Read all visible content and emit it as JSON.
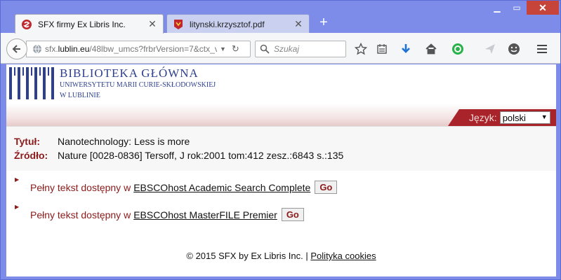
{
  "browser": {
    "tabs": [
      {
        "title": "SFX firmy Ex Libris Inc.",
        "active": true
      },
      {
        "title": "litynski.krzysztof.pdf",
        "active": false
      }
    ],
    "url_prefix": "sfx.",
    "url_domain": "lublin.eu",
    "url_rest": "/48lbw_umcs?frbrVersion=7&ctx_v",
    "search_placeholder": "Szukaj"
  },
  "header": {
    "title": "BIBLIOTEKA GŁÓWNA",
    "subtitle1": "UNIWERSYTETU MARII CURIE-SKŁODOWSKIEJ",
    "subtitle2": "W LUBLINIE",
    "language_label": "Język:",
    "language_value": "polski"
  },
  "record": {
    "title_label": "Tytuł:",
    "title_value": "Nanotechnology: Less is more",
    "source_label": "Źródło:",
    "source_value": "Nature [0028-0836] Tersoff, J rok:2001 tom:412 zesz.:6843 s.:135"
  },
  "links": [
    {
      "text": "Pełny tekst dostępny w",
      "target": "EBSCOhost Academic Search Complete",
      "button": "Go"
    },
    {
      "text": "Pełny tekst dostępny w",
      "target": "EBSCOhost MasterFILE Premier",
      "button": "Go"
    }
  ],
  "footer": {
    "copyright": "© 2015 SFX by Ex Libris Inc. |",
    "cookie_link": "Polityka cookies"
  },
  "colors": {
    "brand_red": "#8b1a1a",
    "brand_blue": "#2d3f8e",
    "lang_band": "#a8242a"
  }
}
